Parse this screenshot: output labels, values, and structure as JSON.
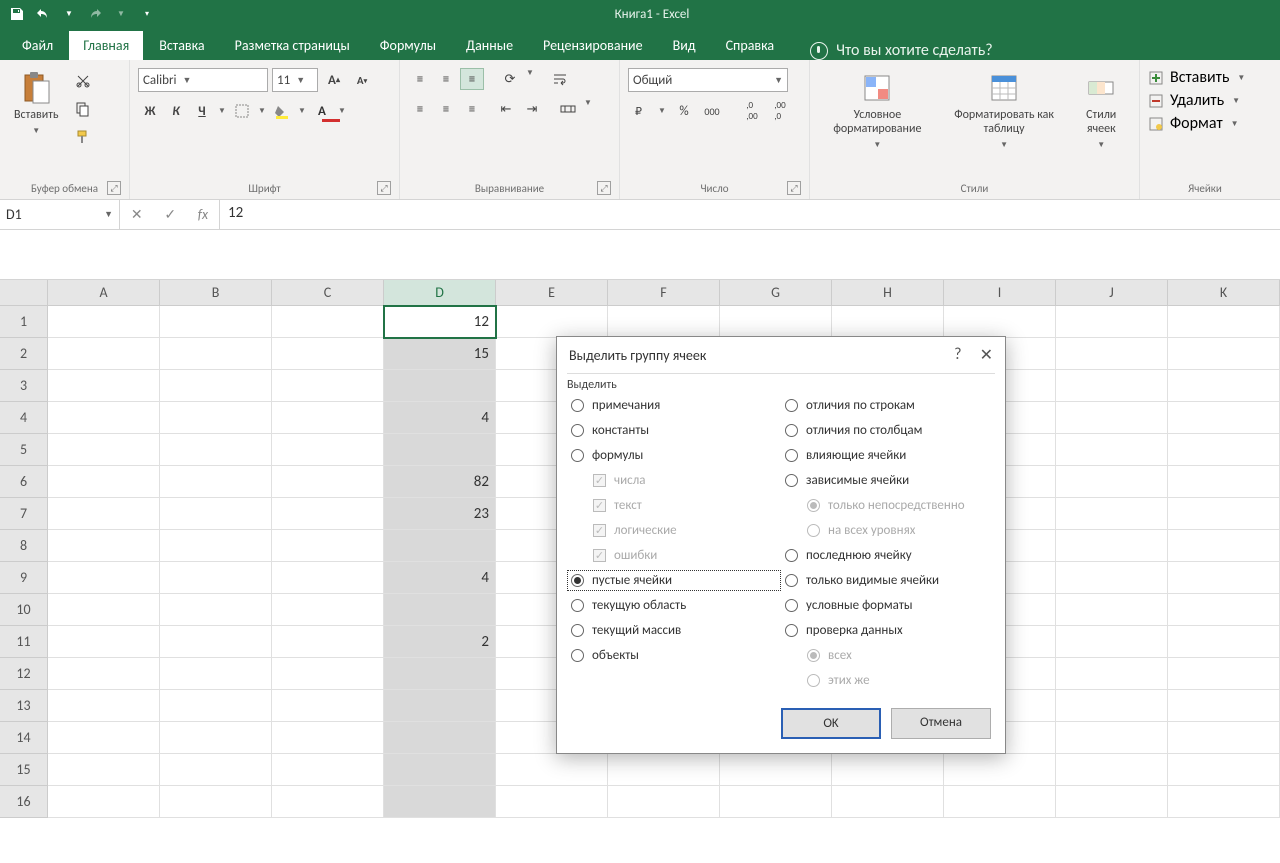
{
  "title": "Книга1  -  Excel",
  "tabs": {
    "file": "Файл",
    "home": "Главная",
    "insert": "Вставка",
    "layout": "Разметка страницы",
    "formulas": "Формулы",
    "data": "Данные",
    "review": "Рецензирование",
    "view": "Вид",
    "help": "Справка"
  },
  "tellme": "Что вы хотите сделать?",
  "ribbon": {
    "clipboard": {
      "paste": "Вставить",
      "label": "Буфер обмена"
    },
    "font": {
      "name": "Calibri",
      "size": "11",
      "label": "Шрифт",
      "bold": "Ж",
      "italic": "К",
      "underline": "Ч"
    },
    "align": {
      "label": "Выравнивание"
    },
    "number": {
      "format": "Общий",
      "label": "Число",
      "percent": "%",
      "thousand": "000"
    },
    "styles": {
      "cond": "Условное форматирование",
      "table": "Форматировать как таблицу",
      "cell": "Стили ячеек",
      "label": "Стили"
    },
    "cells": {
      "insert": "Вставить",
      "delete": "Удалить",
      "format": "Формат",
      "label": "Ячейки"
    }
  },
  "namebox": "D1",
  "formula_value": "12",
  "columns": [
    "A",
    "B",
    "C",
    "D",
    "E",
    "F",
    "G",
    "H",
    "I",
    "J",
    "K"
  ],
  "sel_col_index": 3,
  "row_count": 16,
  "cell_data": {
    "D1": "12",
    "D2": "15",
    "D4": "4",
    "D6": "82",
    "D7": "23",
    "D9": "4",
    "D11": "2"
  },
  "dialog": {
    "title": "Выделить группу ячеек",
    "group": "Выделить",
    "left": [
      {
        "key": "notes",
        "label": "примечания",
        "type": "radio"
      },
      {
        "key": "consts",
        "label": "константы",
        "type": "radio"
      },
      {
        "key": "formulas",
        "label": "формулы",
        "type": "radio"
      },
      {
        "key": "nums",
        "label": "числа",
        "type": "chk"
      },
      {
        "key": "text",
        "label": "текст",
        "type": "chk"
      },
      {
        "key": "logic",
        "label": "логические",
        "type": "chk"
      },
      {
        "key": "err",
        "label": "ошибки",
        "type": "chk"
      },
      {
        "key": "blanks",
        "label": "пустые ячейки",
        "type": "radio",
        "checked": true,
        "focused": true
      },
      {
        "key": "region",
        "label": "текущую область",
        "type": "radio"
      },
      {
        "key": "array",
        "label": "текущий массив",
        "type": "radio"
      },
      {
        "key": "objects",
        "label": "объекты",
        "type": "radio"
      }
    ],
    "right": [
      {
        "key": "rowdiff",
        "label": "отличия по строкам",
        "type": "radio"
      },
      {
        "key": "coldiff",
        "label": "отличия по столбцам",
        "type": "radio"
      },
      {
        "key": "prec",
        "label": "влияющие ячейки",
        "type": "radio"
      },
      {
        "key": "dep",
        "label": "зависимые ячейки",
        "type": "radio"
      },
      {
        "key": "direct",
        "label": "только непосредственно",
        "type": "radio",
        "disabled": true,
        "checked": true,
        "indent": true
      },
      {
        "key": "all",
        "label": "на всех уровнях",
        "type": "radio",
        "disabled": true,
        "indent": true
      },
      {
        "key": "last",
        "label": "последнюю ячейку",
        "type": "radio"
      },
      {
        "key": "vis",
        "label": "только видимые ячейки",
        "type": "radio"
      },
      {
        "key": "condf",
        "label": "условные форматы",
        "type": "radio"
      },
      {
        "key": "valid",
        "label": "проверка данных",
        "type": "radio"
      },
      {
        "key": "allv",
        "label": "всех",
        "type": "radio",
        "disabled": true,
        "checked": true,
        "indent": true
      },
      {
        "key": "same",
        "label": "этих же",
        "type": "radio",
        "disabled": true,
        "indent": true
      }
    ],
    "ok": "OK",
    "cancel": "Отмена"
  }
}
